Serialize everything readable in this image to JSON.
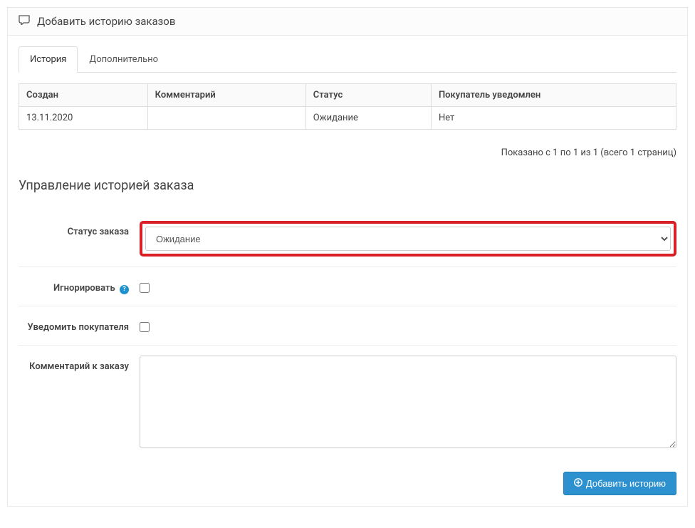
{
  "panel": {
    "title": "Добавить историю заказов"
  },
  "tabs": {
    "history": "История",
    "additional": "Дополнительно"
  },
  "table": {
    "headers": {
      "created": "Создан",
      "comment": "Комментарий",
      "status": "Статус",
      "notified": "Покупатель уведомлен"
    },
    "rows": [
      {
        "created": "13.11.2020",
        "comment": "",
        "status": "Ожидание",
        "notified": "Нет"
      }
    ]
  },
  "pagination_info": "Показано с 1 по 1 из 1 (всего 1 страниц)",
  "section_title": "Управление историей заказа",
  "form": {
    "status_label": "Статус заказа",
    "status_value": "Ожидание",
    "ignore_label": "Игнорировать",
    "notify_label": "Уведомить покупателя",
    "comment_label": "Комментарий к заказу",
    "submit_label": "Добавить историю"
  }
}
